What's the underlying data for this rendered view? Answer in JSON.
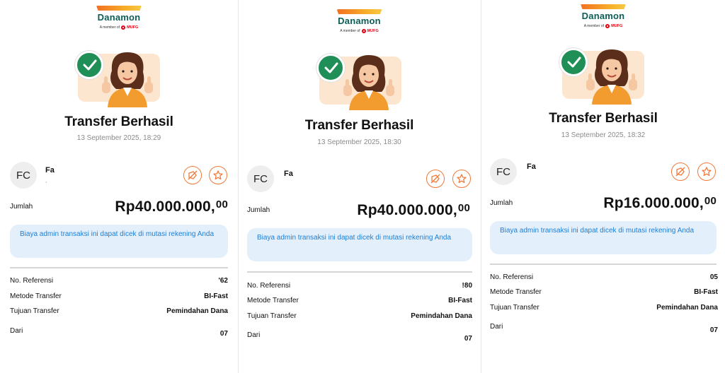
{
  "brand": {
    "name": "Danamon",
    "member_of": "A member of",
    "group": "MUFG"
  },
  "receipts": [
    {
      "status_title": "Transfer Berhasil",
      "timestamp": "13 September 2025, 18:29",
      "recipient": {
        "initials": "FC",
        "name": "Fa",
        "detail": ","
      },
      "amount_label": "Jumlah",
      "amount": "Rp40.000.000,",
      "amount_decimal": "00",
      "info_text": "Biaya admin transaksi ini dapat dicek di mutasi rekening Anda",
      "details": [
        {
          "label": "No. Referensi",
          "value": "'62"
        },
        {
          "label": "Metode Transfer",
          "value": "BI-Fast"
        },
        {
          "label": "Tujuan Transfer",
          "value": "Pemindahan Dana"
        },
        {
          "label": "Dari",
          "value": "07"
        }
      ]
    },
    {
      "status_title": "Transfer Berhasil",
      "timestamp": "13 September 2025, 18:30",
      "recipient": {
        "initials": "FC",
        "name": "Fa",
        "detail": ""
      },
      "amount_label": "Jumlah",
      "amount": "Rp40.000.000,",
      "amount_decimal": "00",
      "info_text": "Biaya admin transaksi ini dapat dicek di mutasi rekening Anda",
      "details": [
        {
          "label": "No. Referensi",
          "value": "!80"
        },
        {
          "label": "Metode Transfer",
          "value": "BI-Fast"
        },
        {
          "label": "Tujuan Transfer",
          "value": "Pemindahan Dana"
        },
        {
          "label": "Dari",
          "value": "07"
        }
      ]
    },
    {
      "status_title": "Transfer Berhasil",
      "timestamp": "13 September 2025, 18:32",
      "recipient": {
        "initials": "FC",
        "name": "Fa",
        "detail": ""
      },
      "amount_label": "Jumlah",
      "amount": "Rp16.000.000,",
      "amount_decimal": "00",
      "info_text": "Biaya admin transaksi ini dapat dicek di mutasi rekening Anda",
      "details": [
        {
          "label": "No. Referensi",
          "value": "05"
        },
        {
          "label": "Metode Transfer",
          "value": "BI-Fast"
        },
        {
          "label": "Tujuan Transfer",
          "value": "Pemindahan Dana"
        },
        {
          "label": "Dari",
          "value": "07"
        }
      ]
    }
  ],
  "icons": {
    "check": "check-circle-icon",
    "share": "share-icon",
    "favorite": "star-icon"
  },
  "colors": {
    "brand_green": "#0c5e57",
    "success_green": "#1f8f57",
    "accent_orange": "#f07a3a",
    "info_blue": "#1c7ed6",
    "info_bg": "#e3f0fb"
  }
}
